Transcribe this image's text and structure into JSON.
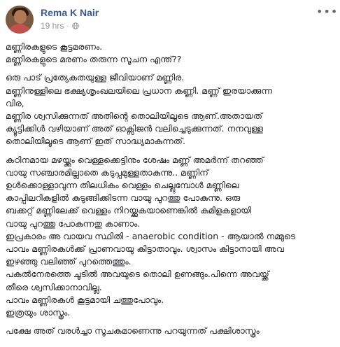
{
  "post": {
    "author": "Rema K Nair",
    "time": "19 hrs",
    "separator": "·",
    "paragraphs": [
      [
        "മണ്ണിരകളുടെ കൂട്ടമരണം.",
        "മണ്ണിരകളുടെ മരണം തരുന്ന സൂചന എന്ത്??"
      ],
      [
        "ഒരു പാട് പ്രത്യേകതയുള്ള ജീവിയാണ് മണ്ണിര.",
        "മണ്ണിനുള്ളിലെ ഭക്ഷ്യശൃംഖലയിലെ പ്രധാന കണ്ണി. മണ്ണ് ഇരയാക്കുന്ന",
        "വിര,",
        "മണ്ണിര ശ്വസിക്കുന്നത് അതിന്റെ തൊലിയിലൂടെ ആണ്.അതായത്",
        "ക്യൂട്ടിക്കിൾ വഴിയാണ് അത് ഓക്സിജൻ വലിച്ചെടുക്കുന്നത്. നനവുള്ള",
        "തൊലിയിലൂടെ ആണ് ഇത് സാദ്ധ്യമാകുന്നത്."
      ],
      [
        "കഠിനമായ മഴയ്ക്കും വെള്ളക്കെട്ടിനും ശേഷം മണ്ണ് അമർന്ന് തറഞ്ഞ്",
        "വായു സഞ്ചാരമില്ലാതെ കടുപ്പമുള്ളതാകുന്നു.. മണ്ണിന്",
        "ഉൾക്കൊള്ളാവുന്ന തിലധികം വെള്ളം ചെല്ലുമ്പോൾ മണ്ണിലെ",
        "കാപ്പിലറികളിൽ കുടുങ്ങിക്കിടന്ന വായു പുറത്തു പോകുന്നു. ഒരു",
        "ബക്കറ്റ് മണ്ണിലേക്ക് വെള്ളം നിറയ്ക്കുകയാണെങ്കിൽ കുമിളകളായി",
        "വായു പുറത്തു പോകുന്നതു കാണാം.",
        "ഇപ്രകാരം അ വായവ സ്ഥിതി - anaerobic condition - ആയാൽ നമ്മുടെ",
        "പാവം മണ്ണിരകൾക്ക് പ്രാണവായു കിട്ടാതാവും. ശ്വാസം കിട്ടാനായി അവ",
        "ഇഴഞ്ഞു വലിഞ്ഞ് പുറത്തെത്തും.",
        "പകൽനേരത്തെ ചൂടിൽ അവയുടെ തൊലി ഉണങ്ങും.പിന്നെ അവയ്ക്ക്",
        "തീരെ ശ്വസിക്കാനാവില്ല.",
        "പാവം മണ്ണിരകൾ കൂട്ടമായി ചത്തുപോവും.",
        "ഇത്രയും ശാസ്ത്രം."
      ],
      [
        "പക്ഷേ അത് വരൾച്ചാ സൂചകമാണെന്നു പറയുന്നത് പക്ഷിശാസ്ത്രം"
      ]
    ]
  },
  "icons": {
    "privacy": "globe-icon",
    "more": "more-options-icon"
  },
  "colors": {
    "author": "#385898",
    "meta": "#90949c",
    "text": "#1c1e21"
  }
}
